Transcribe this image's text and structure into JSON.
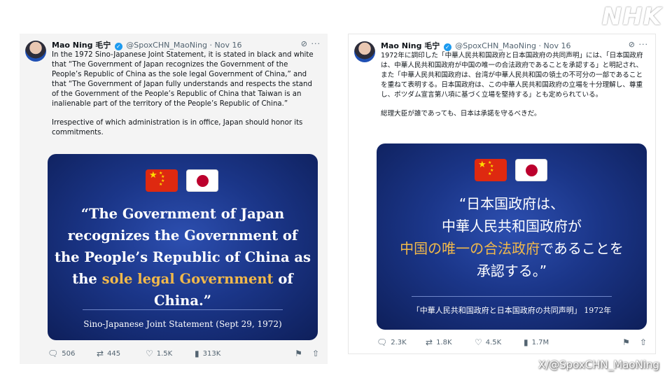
{
  "logo": "NHK",
  "credit": "X/@SpoxCHN_MaoNing",
  "tweets": [
    {
      "author": "Mao Ning 毛宁",
      "handle": "@SpoxCHN_MaoNing",
      "date": "· Nov 16",
      "menu": "···",
      "paragraph1": "In the 1972 Sino-Japanese Joint Statement, it is stated in black and white that “The Government of Japan recognizes the Government of the People’s Republic of China as the sole legal Government of China,” and that “The Government of Japan fully understands and respects the stand of the Government of the People’s Republic of China that Taiwan is an inalienable part of the territory of the People’s Republic of China.”",
      "paragraph2": "Irrespective of which administration is in office, Japan should honor its commitments.",
      "quote_before": "“The Government of Japan recognizes the Government of the People’s Republic of China as the ",
      "quote_highlight": "sole legal Government",
      "quote_after": " of China.”",
      "caption": "Sino-Japanese Joint Statement (Sept 29, 1972)",
      "replies": "506",
      "reposts": "445",
      "likes": "1.5K",
      "views": "313K"
    },
    {
      "author": "Mao Ning 毛宁",
      "handle": "@SpoxCHN_MaoNing",
      "date": "· Nov 16",
      "menu": "···",
      "paragraph1": "1972年に調印した「中華人民共和国政府と日本国政府の共同声明」には、「日本国政府は、中華人民共和国政府が中国の唯一の合法政府であることを承認する」と明記され、また「中華人民共和国政府は、台湾が中華人民共和国の領土の不可分の一部であることを重ねて表明する。日本国政府は、この中華人民共和国政府の立場を十分理解し、尊重し、ポツダム宣言第八項に基づく立場を堅持する」とも定められている。",
      "paragraph2": "総理大臣が誰であっても、日本は承諾を守るべきだ。",
      "quote_line1": "“日本国政府は、",
      "quote_line2": "中華人民共和国政府が",
      "quote_highlight": "中国の唯一の合法政府",
      "quote_line3_rest": "であることを",
      "quote_line4": "承認する。”",
      "caption": "「中華人民共和国政府と日本国政府の共同声明」 1972年",
      "replies": "2.3K",
      "reposts": "1.8K",
      "likes": "4.5K",
      "views": "1.7M"
    }
  ],
  "colors": {
    "highlight": "#f2b94a",
    "card_bg": "#1b3689",
    "verified": "#1d9bf0"
  },
  "icons": [
    "reply-icon",
    "repost-icon",
    "like-icon",
    "views-icon",
    "bookmark-icon",
    "share-icon",
    "grok-icon"
  ]
}
